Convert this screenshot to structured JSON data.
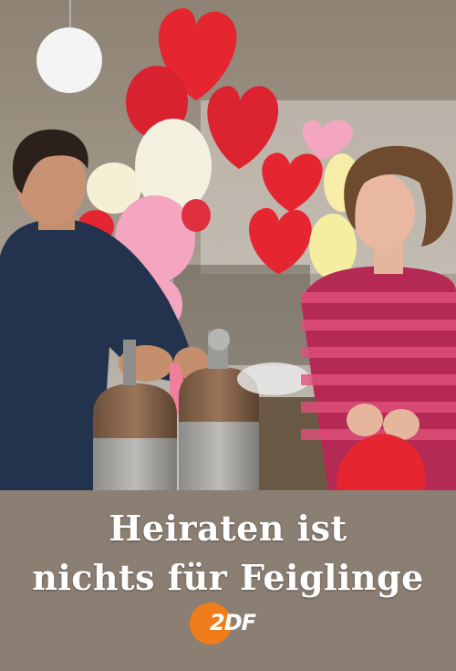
{
  "poster": {
    "title_line1": "Heiraten ist",
    "title_line2": "nichts für Feiglinge",
    "logo_text": "2DF"
  },
  "colors": {
    "band": "#8b7e73",
    "logo_orange": "#f07d1a",
    "balloon_red": "#e52630",
    "balloon_pink": "#f4a6c0",
    "balloon_white": "#f3f0e0"
  }
}
